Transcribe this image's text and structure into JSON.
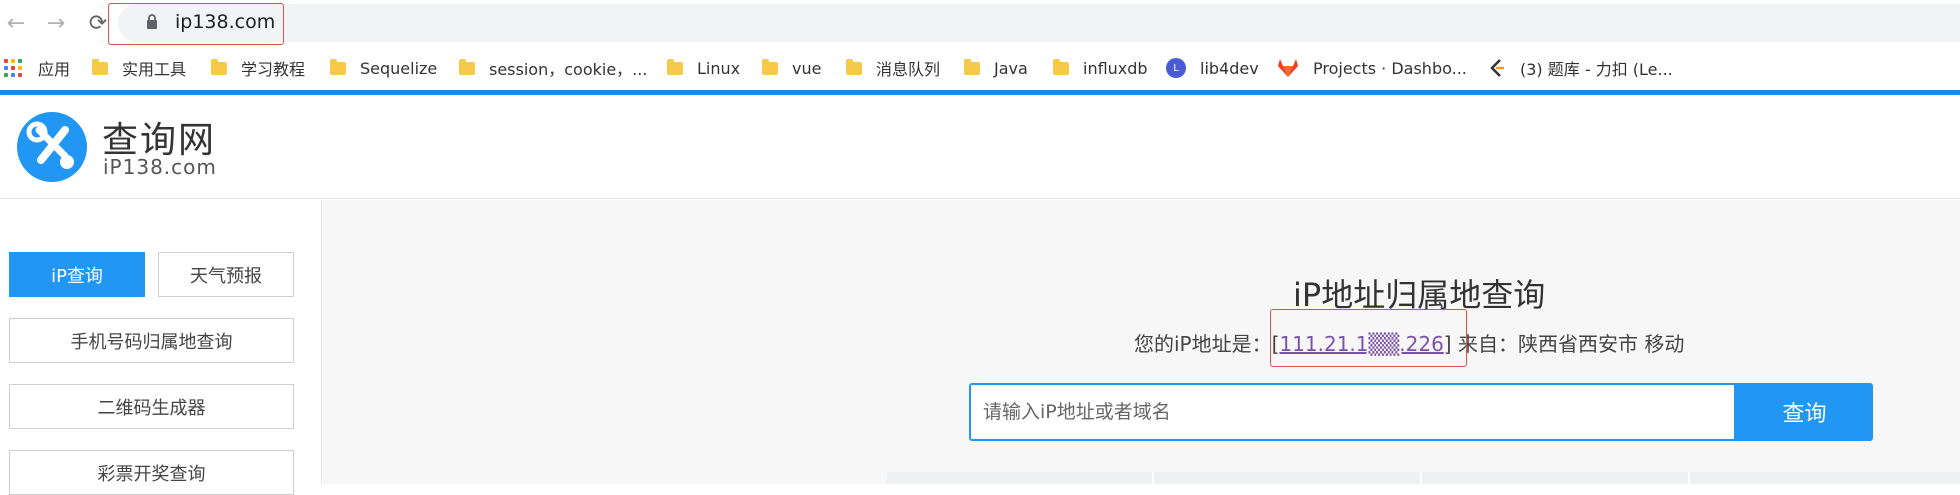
{
  "browser": {
    "back_icon": "arrow-left-icon",
    "forward_icon": "arrow-right-icon",
    "reload_icon": "reload-icon",
    "url": "ip138.com"
  },
  "bookmarks": [
    {
      "label": "应用",
      "icon": "apps-grid-icon"
    },
    {
      "label": "实用工具",
      "icon": "folder-icon"
    },
    {
      "label": "学习教程",
      "icon": "folder-icon"
    },
    {
      "label": "Sequelize",
      "icon": "folder-icon"
    },
    {
      "label": "session，cookie，...",
      "icon": "folder-icon"
    },
    {
      "label": "Linux",
      "icon": "folder-icon"
    },
    {
      "label": "vue",
      "icon": "folder-icon"
    },
    {
      "label": "消息队列",
      "icon": "folder-icon"
    },
    {
      "label": "Java",
      "icon": "folder-icon"
    },
    {
      "label": "influxdb",
      "icon": "folder-icon"
    },
    {
      "label": "lib4dev",
      "icon": "lib4dev-icon"
    },
    {
      "label": "Projects · Dashbo...",
      "icon": "gitlab-icon"
    },
    {
      "label": "(3) 题库 - 力扣 (Le...",
      "icon": "leetcode-icon"
    }
  ],
  "site": {
    "name": "查询网",
    "domain": "iP138.com",
    "logo_icon": "tools-icon"
  },
  "sidebar": {
    "tab_ip": "iP查询",
    "tab_weather": "天气预报",
    "items": [
      "手机号码归属地查询",
      "二维码生成器",
      "彩票开奖查询"
    ]
  },
  "main": {
    "title": "iP地址归属地查询",
    "ip_prefix": "您的iP地址是：",
    "ip_open": "[",
    "ip_value": "111.21.1▒▒.226",
    "ip_close": "]",
    "ip_from": " 来自：陕西省西安市 移动",
    "search_placeholder": "请输入iP地址或者域名",
    "search_button": "查询"
  },
  "colors": {
    "accent": "#2196f3",
    "highlight_box": "#e05050",
    "link": "#7b52ab"
  }
}
